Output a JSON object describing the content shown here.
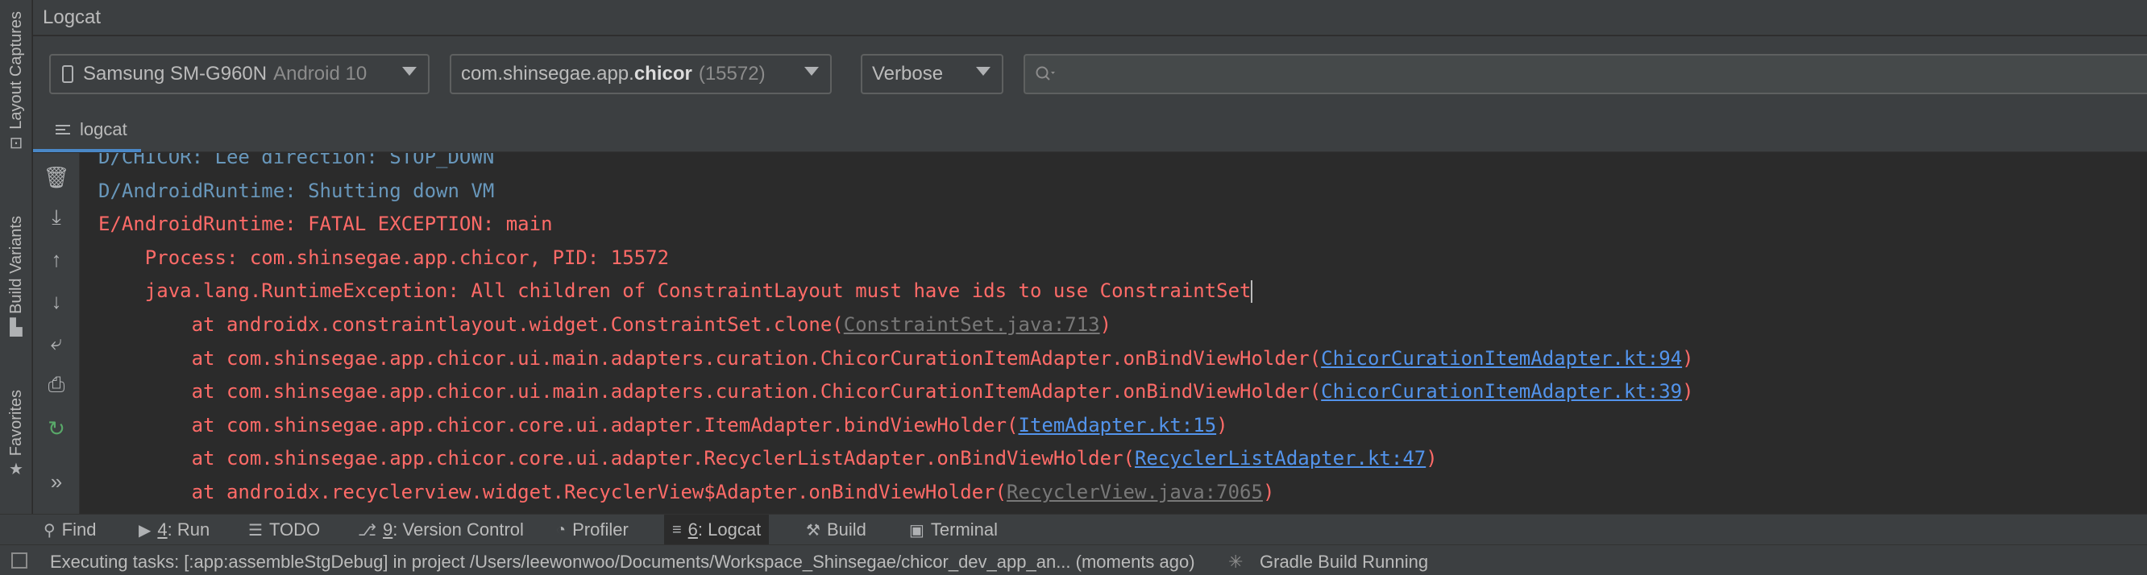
{
  "window": {
    "title": "Logcat"
  },
  "left_strip": {
    "tabs": [
      {
        "label": "Layout Captures",
        "icon": "layout-captures-icon"
      },
      {
        "label": "Build Variants",
        "icon": "build-variants-icon"
      },
      {
        "label": "Favorites",
        "icon": "star-icon"
      }
    ]
  },
  "toolbar": {
    "device": {
      "name": "Samsung SM-G960N",
      "os": "Android 10"
    },
    "process": {
      "prefix": "com.shinsegae.app.",
      "bold": "chicor",
      "pid": "(15572)"
    },
    "log_level": "Verbose",
    "search": {
      "value": "",
      "placeholder": ""
    }
  },
  "tabs": [
    {
      "label": "logcat",
      "active": true
    }
  ],
  "actions": [
    {
      "name": "clear-logcat-icon",
      "glyph": "🗑"
    },
    {
      "name": "scroll-to-end-icon",
      "glyph": "⤓"
    },
    {
      "name": "up-arrow-icon",
      "glyph": "↑"
    },
    {
      "name": "down-arrow-icon",
      "glyph": "↓"
    },
    {
      "name": "soft-wrap-icon",
      "glyph": "⤶"
    },
    {
      "name": "print-icon",
      "glyph": "⎙"
    },
    {
      "name": "restart-icon",
      "glyph": "↻"
    },
    {
      "name": "more-icon",
      "glyph": "»"
    }
  ],
  "log_lines": [
    {
      "level": "d",
      "text": "D/CHICOR: Lee direction: STOP_DOWN"
    },
    {
      "level": "d",
      "text": "D/AndroidRuntime: Shutting down VM"
    },
    {
      "level": "e",
      "text": "E/AndroidRuntime: FATAL EXCEPTION: main"
    },
    {
      "level": "e",
      "text": "    Process: com.shinsegae.app.chicor, PID: 15572"
    },
    {
      "level": "e",
      "text": "    java.lang.RuntimeException: All children of ConstraintLayout must have ids to use ConstraintSet"
    },
    {
      "level": "e",
      "text": "        at androidx.constraintlayout.widget.ConstraintSet.clone(",
      "link": "ConstraintSet.java:713",
      "link_style": "gray",
      "suffix": ")"
    },
    {
      "level": "e",
      "text": "        at com.shinsegae.app.chicor.ui.main.adapters.curation.ChicorCurationItemAdapter.onBindViewHolder(",
      "link": "ChicorCurationItemAdapter.kt:94",
      "link_style": "blue",
      "suffix": ")"
    },
    {
      "level": "e",
      "text": "        at com.shinsegae.app.chicor.ui.main.adapters.curation.ChicorCurationItemAdapter.onBindViewHolder(",
      "link": "ChicorCurationItemAdapter.kt:39",
      "link_style": "blue",
      "suffix": ")"
    },
    {
      "level": "e",
      "text": "        at com.shinsegae.app.chicor.core.ui.adapter.ItemAdapter.bindViewHolder(",
      "link": "ItemAdapter.kt:15",
      "link_style": "blue",
      "suffix": ")"
    },
    {
      "level": "e",
      "text": "        at com.shinsegae.app.chicor.core.ui.adapter.RecyclerListAdapter.onBindViewHolder(",
      "link": "RecyclerListAdapter.kt:47",
      "link_style": "blue",
      "suffix": ")"
    },
    {
      "level": "e",
      "text": "        at androidx.recyclerview.widget.RecyclerView$Adapter.onBindViewHolder(",
      "link": "RecyclerView.java:7065",
      "link_style": "gray",
      "suffix": ")"
    }
  ],
  "tool_windows": [
    {
      "name": "find",
      "icon": "search-icon",
      "glyph": "⚲",
      "mnemonic": "",
      "label": "Find",
      "active": false
    },
    {
      "name": "run",
      "icon": "run-icon",
      "glyph": "▶",
      "mnemonic": "4",
      "label": ": Run",
      "active": false
    },
    {
      "name": "todo",
      "icon": "todo-icon",
      "glyph": "☰",
      "mnemonic": "",
      "label": "TODO",
      "active": false
    },
    {
      "name": "version-control",
      "icon": "vcs-icon",
      "glyph": "⎇",
      "mnemonic": "9",
      "label": ": Version Control",
      "active": false
    },
    {
      "name": "profiler",
      "icon": "profiler-icon",
      "glyph": "◔",
      "mnemonic": "",
      "label": "Profiler",
      "active": false
    },
    {
      "name": "logcat",
      "icon": "logcat-icon",
      "glyph": "≡",
      "mnemonic": "6",
      "label": ": Logcat",
      "active": true
    },
    {
      "name": "build",
      "icon": "hammer-icon",
      "glyph": "⚒",
      "mnemonic": "",
      "label": "Build",
      "active": false
    },
    {
      "name": "terminal",
      "icon": "terminal-icon",
      "glyph": "▣",
      "mnemonic": "",
      "label": "Terminal",
      "active": false
    }
  ],
  "status": {
    "message": "Executing tasks: [:app:assembleStgDebug] in project /Users/leewonwoo/Documents/Workspace_Shinsegae/chicor_dev_app_an... (moments ago)",
    "task": "Gradle Build Running"
  },
  "colors": {
    "debug": "#6897bb",
    "error": "#ff6b68",
    "link": "#5394ec",
    "link_gray": "#787878",
    "accent": "#4a88c7"
  }
}
